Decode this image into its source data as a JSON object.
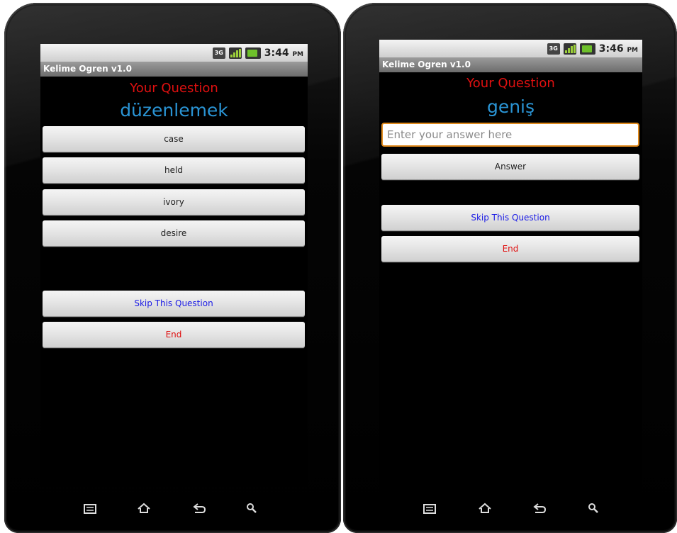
{
  "phones": [
    {
      "status_time": "3:44",
      "status_ampm": "PM",
      "status_network": "3G",
      "app_title": "Kelime Ogren v1.0",
      "question_label": "Your Question",
      "question_word": "düzenlemek",
      "choices": [
        "case",
        "held",
        "ivory",
        "desire"
      ],
      "skip_label": "Skip This Question",
      "end_label": "End"
    },
    {
      "status_time": "3:46",
      "status_ampm": "PM",
      "status_network": "3G",
      "app_title": "Kelime Ogren v1.0",
      "question_label": "Your Question",
      "question_word": "geniş",
      "answer_placeholder": "Enter your answer here",
      "answer_label": "Answer",
      "skip_label": "Skip This Question",
      "end_label": "End"
    }
  ],
  "colors": {
    "question_label": "#e01010",
    "question_word": "#2a94d4",
    "skip_text": "#1a1ae6",
    "end_text": "#e01010",
    "input_border": "#e08a1c"
  },
  "icons": {
    "status": [
      "3g-data-icon",
      "signal-strength-icon",
      "battery-icon"
    ],
    "nav": [
      "menu-icon",
      "home-icon",
      "back-icon",
      "search-icon"
    ]
  }
}
